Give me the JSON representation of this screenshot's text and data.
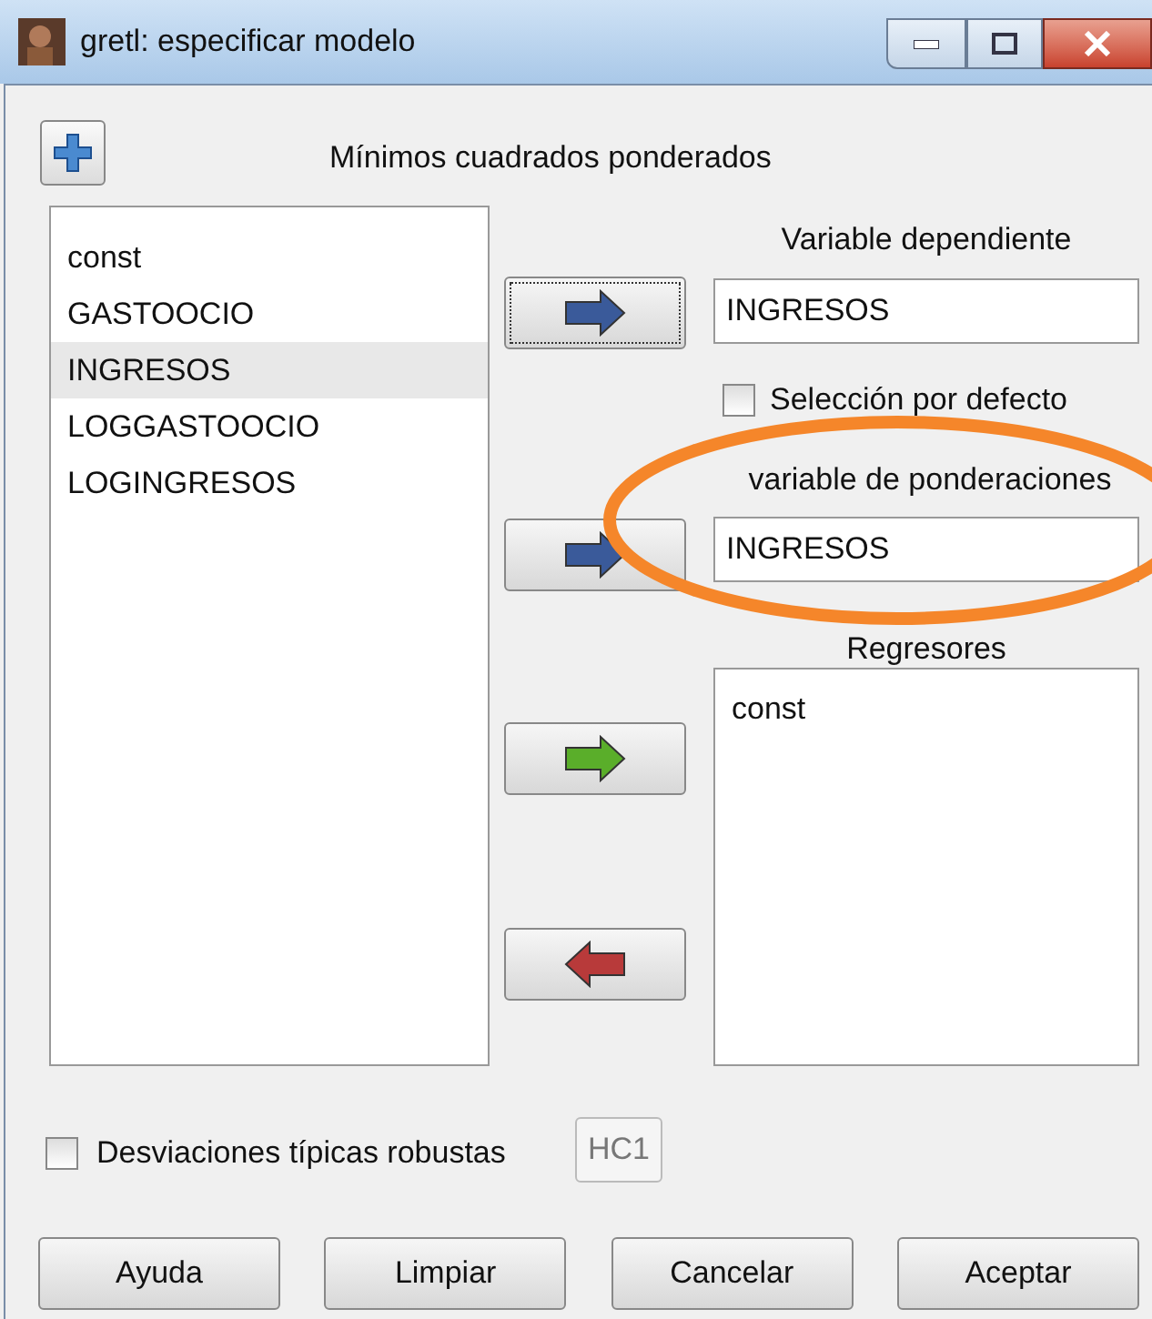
{
  "window": {
    "title": "gretl: especificar modelo"
  },
  "heading": "Mínimos cuadrados ponderados",
  "variables": [
    {
      "label": "const",
      "selected": false
    },
    {
      "label": "GASTOOCIO",
      "selected": false
    },
    {
      "label": "INGRESOS",
      "selected": true
    },
    {
      "label": "LOGGASTOOCIO",
      "selected": false
    },
    {
      "label": "LOGINGRESOS",
      "selected": false
    }
  ],
  "arrow_buttons": [
    {
      "kind": "right",
      "color": "#3a5a9a",
      "focused": true
    },
    {
      "kind": "right",
      "color": "#3a5a9a",
      "focused": false
    },
    {
      "kind": "right",
      "color": "#5aae2a",
      "focused": false
    },
    {
      "kind": "left",
      "color": "#b83a3a",
      "focused": false
    }
  ],
  "dependent": {
    "label": "Variable dependiente",
    "value": "INGRESOS"
  },
  "default_selection": {
    "label": "Selección por defecto",
    "checked": false
  },
  "weights": {
    "label": "variable de ponderaciones",
    "value": "INGRESOS"
  },
  "regressors": {
    "label": "Regresores",
    "items": [
      "const"
    ]
  },
  "robust": {
    "label": "Desviaciones típicas robustas",
    "checked": false,
    "variant": "HC1"
  },
  "buttons": [
    {
      "label": "Ayuda"
    },
    {
      "label": "Limpiar"
    },
    {
      "label": "Cancelar"
    },
    {
      "label": "Aceptar"
    }
  ]
}
